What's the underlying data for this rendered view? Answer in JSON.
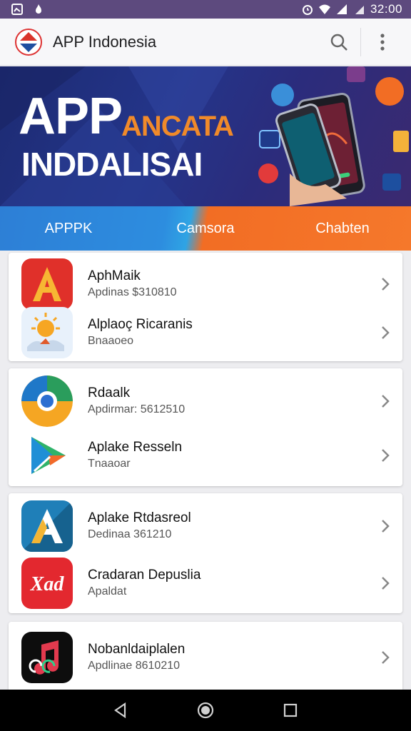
{
  "status_bar": {
    "time": "32:00"
  },
  "app_bar": {
    "title": "APP Indonesia"
  },
  "banner": {
    "headline": "APP",
    "accent_text": "ANCATA",
    "subline": "INDDALISAI"
  },
  "tabs": [
    {
      "label": "APPPK"
    },
    {
      "label": "Camsora"
    },
    {
      "label": "Chabten"
    }
  ],
  "cards": [
    {
      "items": [
        {
          "title": "AphMaik",
          "subtitle": "Apdinas $310810",
          "icon": "letter-a-red-icon"
        },
        {
          "title": "Alplaoç Ricaranis",
          "subtitle": "Bnaaoeo",
          "icon": "weather-sun-icon"
        }
      ]
    },
    {
      "items": [
        {
          "title": "Rdaalk",
          "subtitle": "Apdirmar: 5612510",
          "icon": "browser-circle-icon"
        },
        {
          "title": "Aplake Resseln",
          "subtitle": "Tnaaoar",
          "icon": "play-triangle-icon"
        }
      ]
    },
    {
      "items": [
        {
          "title": "Aplake Rtdasreol",
          "subtitle": "Dedinaa 361210",
          "icon": "letter-a-blue-icon"
        },
        {
          "title": "Cradaran Depuslia",
          "subtitle": "Apaldat",
          "icon": "xad-logo-icon"
        }
      ]
    },
    {
      "items": [
        {
          "title": "Nobanldaiplalen",
          "subtitle": "Apdlinae 8610210",
          "icon": "music-note-icon"
        }
      ]
    }
  ],
  "colors": {
    "status_bar": "#5d4a7e",
    "tab_blue": "#2d8ddf",
    "tab_orange": "#f5782b",
    "banner_bg": "#24358a"
  }
}
